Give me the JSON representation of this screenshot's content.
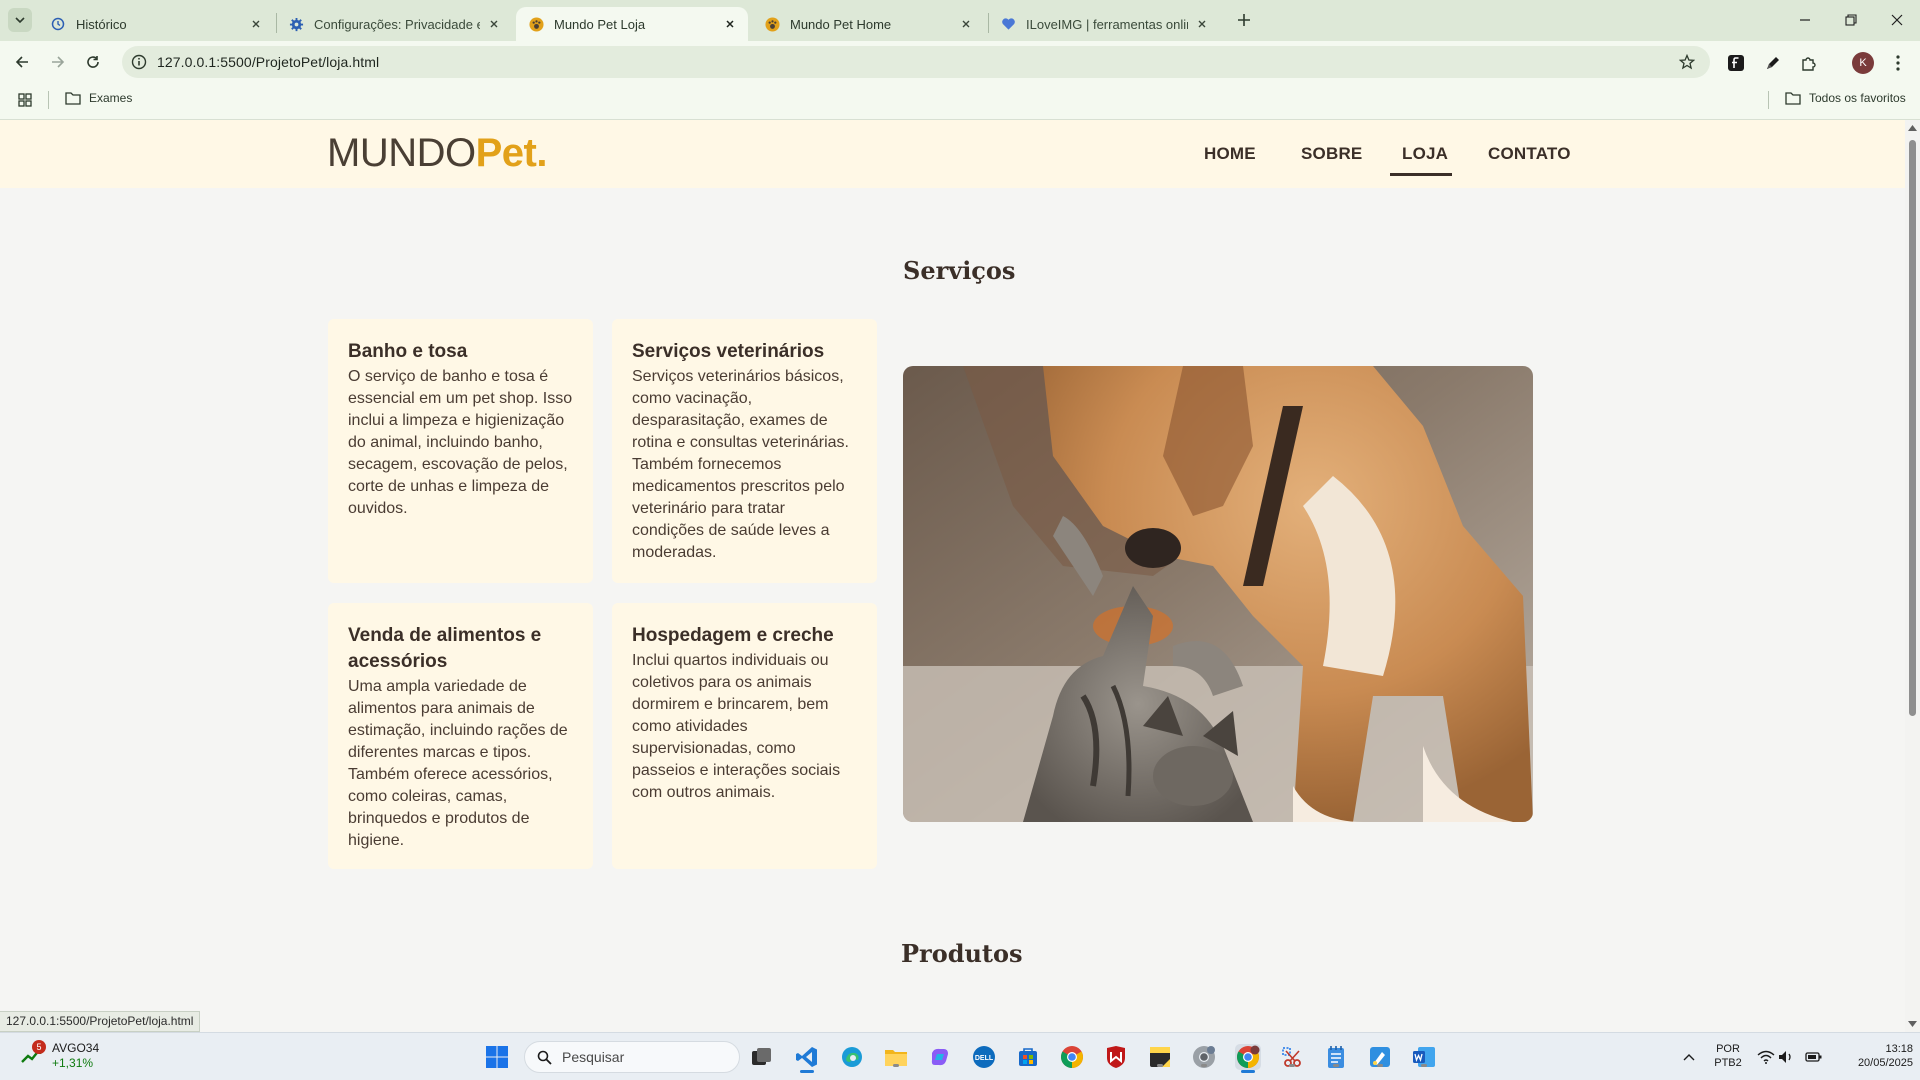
{
  "browser": {
    "tabs": [
      {
        "title": "Histórico",
        "icon": "history-icon",
        "active": false
      },
      {
        "title": "Configurações: Privacidade e se",
        "icon": "gear-icon",
        "active": false
      },
      {
        "title": "Mundo Pet Loja",
        "icon": "paw-icon",
        "active": true
      },
      {
        "title": "Mundo Pet Home",
        "icon": "paw-icon",
        "active": false
      },
      {
        "title": "ILoveIMG | ferramentas online p",
        "icon": "heart-icon",
        "active": false
      }
    ],
    "url": "127.0.0.1:5500/ProjetoPet/loja.html",
    "bookmarks": {
      "folder": "Exames",
      "all_favorites": "Todos os favoritos"
    },
    "profile_initial": "K",
    "status_url": "127.0.0.1:5500/ProjetoPet/loja.html"
  },
  "site": {
    "logo": {
      "part1": "MUNDO",
      "part2": "Pet."
    },
    "nav": [
      {
        "label": "HOME",
        "active": false
      },
      {
        "label": "SOBRE",
        "active": false
      },
      {
        "label": "LOJA",
        "active": true
      },
      {
        "label": "CONTATO",
        "active": false
      }
    ],
    "services_title": "Serviços",
    "services": [
      {
        "title": "Banho e tosa",
        "text": "O serviço de banho e tosa é essencial em um pet shop. Isso inclui a limpeza e higienização do animal, incluindo banho, secagem, escovação de pelos, corte de unhas e limpeza de ouvidos."
      },
      {
        "title": "Serviços veterinários",
        "text": "Serviços veterinários básicos, como vacinação, desparasitação, exames de rotina e consultas veterinárias. Também fornecemos medicamentos prescritos pelo veterinário para tratar condições de saúde leves a moderadas."
      },
      {
        "title": "Venda de alimentos e acessórios",
        "text": "Uma ampla variedade de alimentos para animais de estimação, incluindo rações de diferentes marcas e tipos. Também oferece acessórios, como coleiras, camas, brinquedos e produtos de higiene."
      },
      {
        "title": "Hospedagem e creche",
        "text": "Inclui quartos individuais ou coletivos para os animais dormirem e brincarem, bem como atividades supervisionadas, como passeios e interações sociais com outros animais."
      }
    ],
    "products_title": "Produtos",
    "colors": {
      "brand_brown": "#4a3f34",
      "brand_gold": "#e2a11a",
      "header_bg": "#fff8e6",
      "card_bg": "#fff8e6"
    }
  },
  "taskbar": {
    "stock": {
      "ticker": "AVGO34",
      "change": "+1,31%",
      "badge": "5"
    },
    "search_placeholder": "Pesquisar",
    "language": {
      "line1": "POR",
      "line2": "PTB2"
    },
    "clock": {
      "time": "13:18",
      "date": "20/05/2025"
    }
  }
}
